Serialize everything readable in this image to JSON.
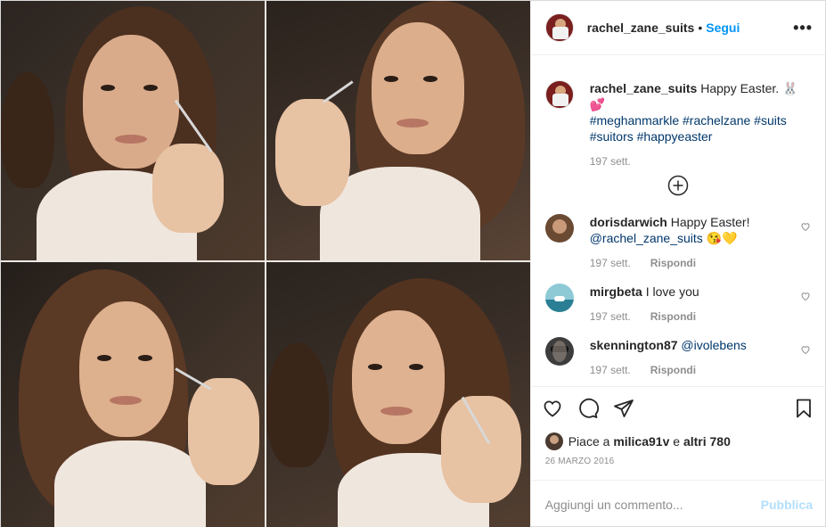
{
  "header": {
    "username": "rachel_zane_suits",
    "separator": "•",
    "follow_label": "Segui",
    "more_label": "•••"
  },
  "caption": {
    "username": "rachel_zane_suits",
    "text": "Happy Easter. 🐰💕",
    "hashtags": "#meghanmarkle #rachelzane #suits #suitors #happyeaster",
    "time": "197 sett."
  },
  "comments": [
    {
      "username": "dorisdarwich",
      "text": "Happy Easter!",
      "mention": "@rachel_zane_suits",
      "emoji": "😘💛",
      "time": "197 sett.",
      "reply": "Rispondi",
      "avatar_color": "#6b4a33"
    },
    {
      "username": "mirgbeta",
      "text": "I love you",
      "mention": "",
      "emoji": "",
      "time": "197 sett.",
      "reply": "Rispondi",
      "avatar_color": "#8ec9d6"
    },
    {
      "username": "skennington87",
      "text": "",
      "mention": "@ivolebens",
      "emoji": "",
      "time": "197 sett.",
      "reply": "Rispondi",
      "avatar_color": "#3d3d3d"
    }
  ],
  "likes": {
    "prefix": "Piace a",
    "user": "milica91v",
    "connector": "e",
    "others": "altri 780"
  },
  "date": "26 MARZO 2016",
  "add_comment": {
    "placeholder": "Aggiungi un commento...",
    "publish_label": "Pubblica"
  },
  "icons": {
    "like": "heart-icon",
    "comment": "comment-icon",
    "share": "paper-plane-icon",
    "save": "bookmark-icon",
    "load_more": "plus-circle-icon"
  },
  "colors": {
    "accent": "#0095f6",
    "publish_disabled": "#b2dffc",
    "hashtag": "#00376b",
    "muted": "#8e8e8e"
  }
}
